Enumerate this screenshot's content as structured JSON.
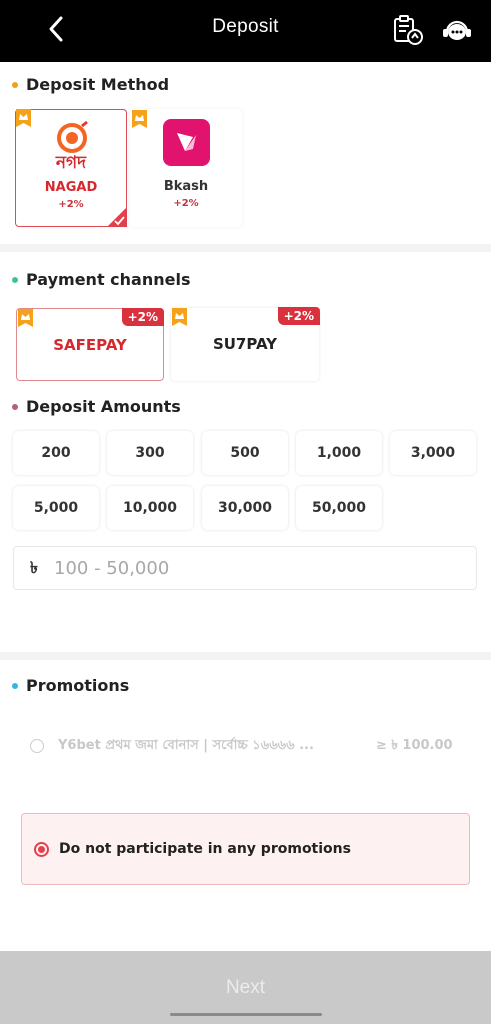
{
  "header": {
    "title": "Deposit"
  },
  "sections": {
    "deposit_method": "Deposit Method",
    "payment_channels": "Payment channels",
    "deposit_amounts": "Deposit Amounts",
    "promotions": "Promotions"
  },
  "methods": [
    {
      "name": "NAGAD",
      "bonus": "+2%",
      "selected": true,
      "logo_text": "নগদ"
    },
    {
      "name": "Bkash",
      "bonus": "+2%",
      "selected": false
    }
  ],
  "channels": [
    {
      "name": "SAFEPAY",
      "badge": "+2%",
      "selected": true
    },
    {
      "name": "SU7PAY",
      "badge": "+2%",
      "selected": false
    }
  ],
  "amounts": [
    "200",
    "300",
    "500",
    "1,000",
    "3,000",
    "5,000",
    "10,000",
    "30,000",
    "50,000"
  ],
  "amount_input": {
    "currency": "৳",
    "placeholder": "100 - 50,000"
  },
  "promotions": {
    "option1": {
      "text": "Y6bet প্রথম জমা বোনাস | সর্বোচ্চ ১৬৬৬৬ ...",
      "min": "≥ ৳ 100.00"
    },
    "no_promo": "Do not participate in any promotions"
  },
  "footer": {
    "next_label": "Next"
  },
  "colors": {
    "accent": "#e0414c",
    "header_bg": "#000000",
    "dot_orange": "#f0a020",
    "dot_teal": "#3cc0a0",
    "dot_purple": "#b06080",
    "dot_cyan": "#30b8e0"
  }
}
